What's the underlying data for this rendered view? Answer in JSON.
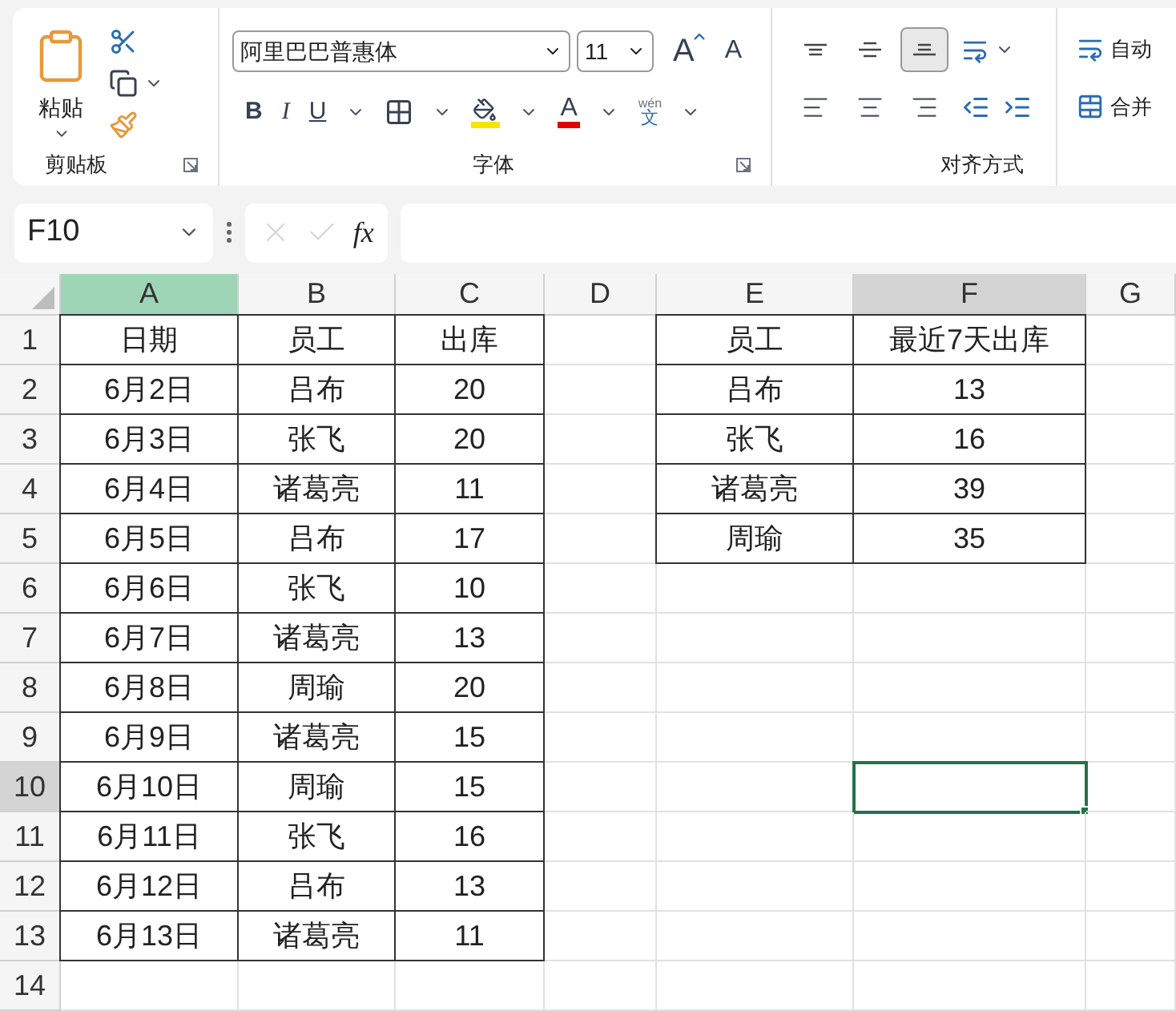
{
  "ribbon": {
    "clipboard": {
      "paste_label": "粘贴",
      "group_label": "剪贴板"
    },
    "font": {
      "font_name": "阿里巴巴普惠体",
      "font_size": "11",
      "grow_label": "A",
      "shrink_label": "A",
      "bold_label": "B",
      "italic_label": "I",
      "underline_label": "U",
      "font_color_label": "A",
      "phonetic_top": "wén",
      "phonetic_bottom": "文",
      "group_label": "字体"
    },
    "alignment": {
      "vertical": [
        {
          "kind": "top",
          "selected": false
        },
        {
          "kind": "middle",
          "selected": false
        },
        {
          "kind": "bottom",
          "selected": true
        }
      ],
      "horizontal": [
        {
          "kind": "left",
          "selected": false
        },
        {
          "kind": "center",
          "selected": false
        },
        {
          "kind": "right",
          "selected": false
        }
      ],
      "group_label": "对齐方式",
      "wrap_label": "自动",
      "merge_label": "合并"
    }
  },
  "formula_bar": {
    "name_box": "F10",
    "fx_label": "fx"
  },
  "sheet": {
    "columns": [
      {
        "label": "A",
        "selected": true,
        "active": false
      },
      {
        "label": "B",
        "selected": false,
        "active": false
      },
      {
        "label": "C",
        "selected": false,
        "active": false
      },
      {
        "label": "D",
        "selected": false,
        "active": false
      },
      {
        "label": "E",
        "selected": false,
        "active": false
      },
      {
        "label": "F",
        "selected": false,
        "active": true
      },
      {
        "label": "G",
        "selected": false,
        "active": false
      }
    ],
    "rows": [
      {
        "number": "1",
        "cells": {
          "A": "日期",
          "B": "员工",
          "C": "出库",
          "E": "员工",
          "F": "最近7天出库"
        }
      },
      {
        "number": "2",
        "cells": {
          "A": "6月2日",
          "B": "吕布",
          "C": "20",
          "E": "吕布",
          "F": "13"
        }
      },
      {
        "number": "3",
        "cells": {
          "A": "6月3日",
          "B": "张飞",
          "C": "20",
          "E": "张飞",
          "F": "16"
        }
      },
      {
        "number": "4",
        "cells": {
          "A": "6月4日",
          "B": "诸葛亮",
          "C": "11",
          "E": "诸葛亮",
          "F": "39"
        }
      },
      {
        "number": "5",
        "cells": {
          "A": "6月5日",
          "B": "吕布",
          "C": "17",
          "E": "周瑜",
          "F": "35"
        }
      },
      {
        "number": "6",
        "cells": {
          "A": "6月6日",
          "B": "张飞",
          "C": "10"
        }
      },
      {
        "number": "7",
        "cells": {
          "A": "6月7日",
          "B": "诸葛亮",
          "C": "13"
        }
      },
      {
        "number": "8",
        "cells": {
          "A": "6月8日",
          "B": "周瑜",
          "C": "20"
        }
      },
      {
        "number": "9",
        "cells": {
          "A": "6月9日",
          "B": "诸葛亮",
          "C": "15"
        }
      },
      {
        "number": "10",
        "active": true,
        "cells": {
          "A": "6月10日",
          "B": "周瑜",
          "C": "15"
        }
      },
      {
        "number": "11",
        "cells": {
          "A": "6月11日",
          "B": "张飞",
          "C": "16"
        }
      },
      {
        "number": "12",
        "cells": {
          "A": "6月12日",
          "B": "吕布",
          "C": "13"
        }
      },
      {
        "number": "13",
        "cells": {
          "A": "6月13日",
          "B": "诸葛亮",
          "C": "11"
        }
      },
      {
        "number": "14",
        "cells": {}
      }
    ]
  }
}
